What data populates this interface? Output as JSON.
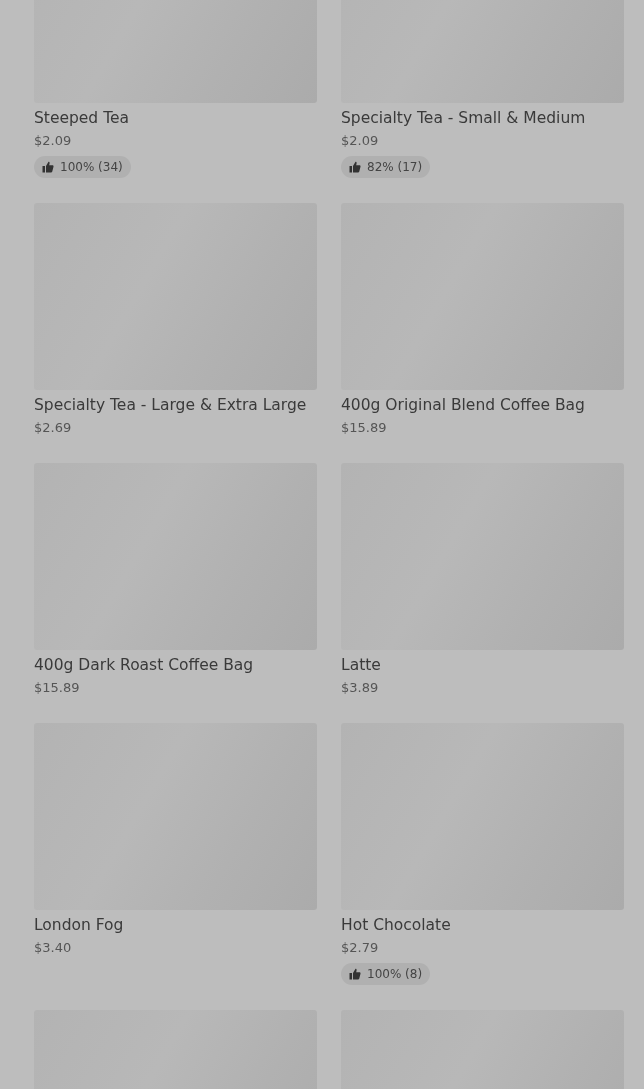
{
  "products": [
    {
      "kind": "product",
      "name": "Steeped Tea",
      "price": "$2.09",
      "rating": "100% (34)"
    },
    {
      "kind": "product",
      "name": "Specialty Tea - Small & Medium",
      "price": "$2.09",
      "rating": "82% (17)"
    },
    {
      "kind": "product",
      "name": "Specialty Tea - Large & Extra Large",
      "price": "$2.69"
    },
    {
      "kind": "product",
      "name": "400g Original Blend Coffee Bag",
      "price": "$15.89"
    },
    {
      "kind": "product",
      "name": "400g Dark Roast Coffee Bag",
      "price": "$15.89"
    },
    {
      "kind": "product",
      "name": "Latte",
      "price": "$3.89"
    },
    {
      "kind": "product",
      "name": "London Fog",
      "price": "$3.40"
    },
    {
      "kind": "product",
      "name": "Hot Chocolate",
      "price": "$2.79",
      "rating": "100% (8)"
    },
    {
      "kind": "image"
    },
    {
      "kind": "image"
    }
  ]
}
